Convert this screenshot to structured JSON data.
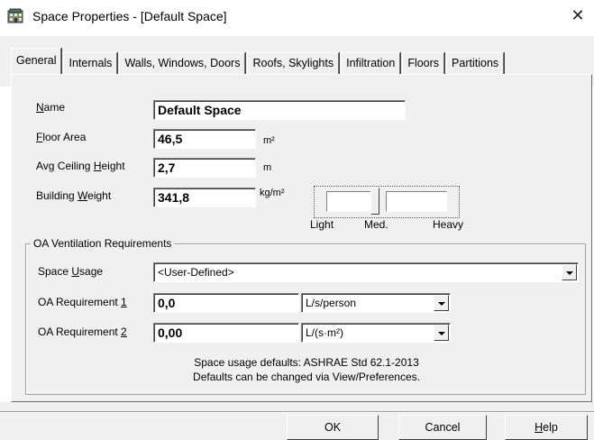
{
  "window": {
    "title": "Space Properties - [Default Space]",
    "close_glyph": "✕",
    "icon": "building-app-icon"
  },
  "tabs": [
    {
      "label": "General",
      "active": true
    },
    {
      "label": "Internals",
      "active": false
    },
    {
      "label": "Walls, Windows, Doors",
      "active": false
    },
    {
      "label": "Roofs, Skylights",
      "active": false
    },
    {
      "label": "Infiltration",
      "active": false
    },
    {
      "label": "Floors",
      "active": false
    },
    {
      "label": "Partitions",
      "active": false
    }
  ],
  "general": {
    "name": {
      "label_pre": "",
      "label_key": "N",
      "label_post": "ame",
      "value": "Default Space"
    },
    "floor_area": {
      "label_pre": "",
      "label_key": "F",
      "label_post": "loor Area",
      "value": "46,5",
      "unit": "m²"
    },
    "ceiling_height": {
      "label_pre": "Avg Ceiling ",
      "label_key": "H",
      "label_post": "eight",
      "value": "2,7",
      "unit": "m"
    },
    "building_weight": {
      "label_pre": "Building ",
      "label_key": "W",
      "label_post": "eight",
      "value": "341,8",
      "unit": "kg/m²"
    },
    "weight_scale": {
      "light": "Light",
      "medium": "Med.",
      "heavy": "Heavy",
      "level": 0.4
    }
  },
  "oa_ventilation": {
    "group_title": "OA Ventilation Requirements",
    "space_usage": {
      "label_pre": "Space ",
      "label_key": "U",
      "label_post": "sage",
      "value": "<User-Defined>"
    },
    "req1": {
      "label_pre": "OA Requirement ",
      "label_key": "1",
      "label_post": "",
      "value": "0,0",
      "unit": "L/s/person"
    },
    "req2": {
      "label_pre": "OA Requirement ",
      "label_key": "2",
      "label_post": "",
      "value": "0,00",
      "unit": "L/(s·m²)"
    },
    "note_line1": "Space usage defaults: ASHRAE Std 62.1-2013",
    "note_line2": "Defaults can be changed via View/Preferences."
  },
  "buttons": {
    "ok": "OK",
    "cancel": "Cancel",
    "help_key": "H",
    "help_post": "elp"
  },
  "colors": {
    "dialog_bg": "#f0f0f0",
    "field_bg": "#ffffff"
  }
}
